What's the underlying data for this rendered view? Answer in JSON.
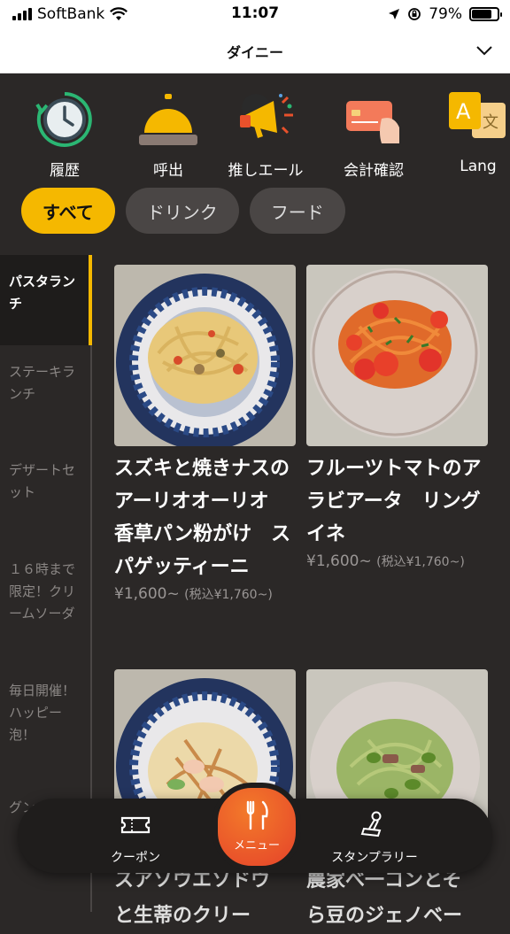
{
  "status_bar": {
    "carrier": "SoftBank",
    "time": "11:07",
    "battery": "79%"
  },
  "header": {
    "title": "ダイニー"
  },
  "quick_actions": [
    {
      "label": "履歴",
      "icon": "history-clock-icon"
    },
    {
      "label": "呼出",
      "icon": "service-bell-icon"
    },
    {
      "label": "推しエール",
      "icon": "megaphone-icon"
    },
    {
      "label": "会計確認",
      "icon": "credit-card-icon"
    },
    {
      "label": "Lang",
      "icon": "language-icon"
    }
  ],
  "filters": [
    {
      "label": "すべて",
      "active": true
    },
    {
      "label": "ドリンク",
      "active": false
    },
    {
      "label": "フード",
      "active": false
    }
  ],
  "categories": [
    {
      "label": "パスタランチ",
      "active": true
    },
    {
      "label": "ステーキランチ",
      "active": false
    },
    {
      "label": "デザートセット",
      "active": false
    },
    {
      "label": "１６時まで限定！クリームソーダ",
      "active": false
    },
    {
      "label": "毎日開催！ハッピー泡！",
      "active": false
    },
    {
      "label": "グン",
      "active": false
    }
  ],
  "menu_items": [
    {
      "name": "スズキと焼きナスのアーリオオーリオ　香草パン粉がけ　スパゲッティーニ",
      "price": "¥1,600~",
      "price_tax": "(税込¥1,760~)"
    },
    {
      "name": "フルーツトマトのアラビアータ　リングイネ",
      "price": "¥1,600~",
      "price_tax": "(税込¥1,760~)"
    },
    {
      "name": "",
      "price": "",
      "price_tax": ""
    },
    {
      "name": "",
      "price": "",
      "price_tax": ""
    }
  ],
  "partial_text": {
    "left": "スアソウエソドウ\nと生蒂のクリー",
    "right": "農家べ一コンとそ\nら豆のジェノベー"
  },
  "bottom_nav": {
    "coupon": "クーポン",
    "menu": "メニュー",
    "stamp": "スタンプラリー"
  },
  "colors": {
    "accent": "#f5b800",
    "background": "#2b2827",
    "menu_button": "#e9512b"
  }
}
